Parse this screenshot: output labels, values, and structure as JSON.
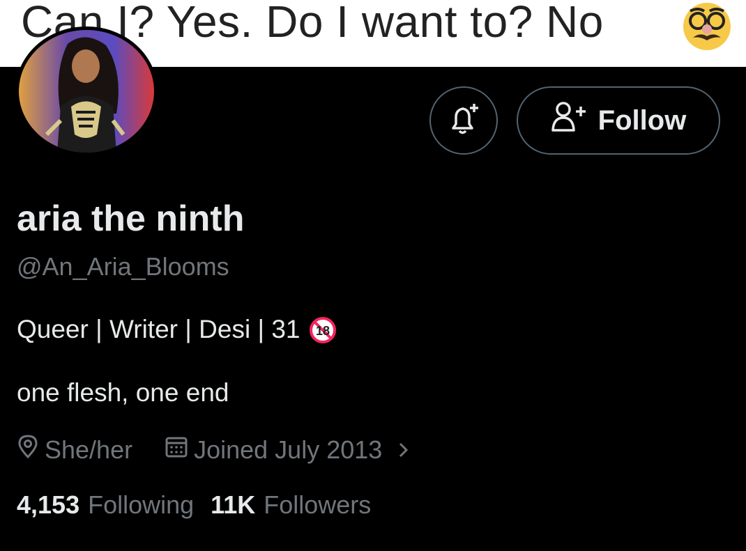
{
  "banner": {
    "text": "Can I? Yes. Do I want to? No",
    "emoji_icon": "disguised-face-emoji"
  },
  "profile": {
    "display_name": "aria the ninth",
    "handle": "@An_Aria_Blooms",
    "bio_line1": "Queer | Writer | Desi | 31",
    "bio_badge_icon": "no-one-under-18-icon",
    "bio_line2": "one flesh, one end",
    "pronouns": "She/her",
    "joined": "Joined July 2013"
  },
  "actions": {
    "notify_icon": "bell-plus-icon",
    "follow_label": "Follow"
  },
  "stats": {
    "following_count": "4,153",
    "following_label": "Following",
    "followers_count": "11K",
    "followers_label": "Followers"
  },
  "colors": {
    "background": "#000000",
    "primary_text": "#e7e9ea",
    "secondary_text": "#71767b",
    "border": "#536471",
    "badge_red": "#f4245e"
  }
}
